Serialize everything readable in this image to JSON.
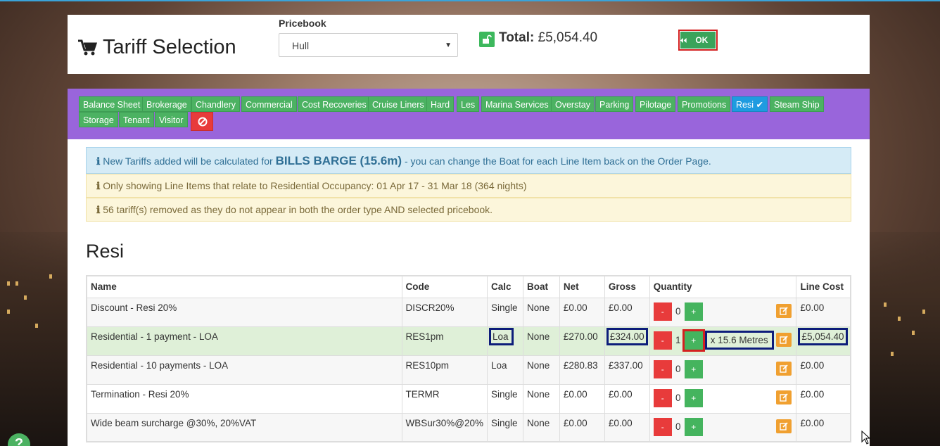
{
  "header": {
    "title": "Tariff Selection",
    "pricebook_label": "Pricebook",
    "pricebook_value": "Hull",
    "total_label": "Total:",
    "total_value": "£5,054.40",
    "ok_label": "OK"
  },
  "categories": [
    {
      "label": "Balance Sheet"
    },
    {
      "label": "Brokerage"
    },
    {
      "label": "Chandlery"
    },
    {
      "label": "Commercial"
    },
    {
      "label": "Cost Recoveries"
    },
    {
      "label": "Cruise Liners"
    },
    {
      "label": "Hard"
    },
    {
      "label": "Les"
    },
    {
      "label": "Marina Services"
    },
    {
      "label": "Overstay"
    },
    {
      "label": "Parking"
    },
    {
      "label": "Pilotage"
    },
    {
      "label": "Promotions"
    },
    {
      "label": "Resi",
      "active": true
    },
    {
      "label": "Steam Ship"
    },
    {
      "label": "Storage"
    },
    {
      "label": "Tenant"
    },
    {
      "label": "Visitor"
    }
  ],
  "alerts": {
    "info_prefix": "New Tariffs added will be calculated for",
    "info_boat": "BILLS BARGE (15.6m)",
    "info_suffix": "- you can change the Boat for each Line Item back on the Order Page.",
    "occupancy": "Only showing Line Items that relate to Residential Occupancy: 01 Apr 17 - 31 Mar 18 (364 nights)",
    "removed": "56 tariff(s) removed as they do not appear in both the order type AND selected pricebook."
  },
  "section_title": "Resi",
  "table": {
    "headers": {
      "name": "Name",
      "code": "Code",
      "calc": "Calc",
      "boat": "Boat",
      "net": "Net",
      "gross": "Gross",
      "quantity": "Quantity",
      "line_cost": "Line Cost"
    },
    "rows": [
      {
        "name": "Discount - Resi 20%",
        "code": "DISCR20%",
        "calc": "Single",
        "boat": "None",
        "net": "£0.00",
        "gross": "£0.00",
        "qty": "0",
        "line_cost": "£0.00"
      },
      {
        "name": "Residential - 1 payment - LOA",
        "code": "RES1pm",
        "calc": "Loa",
        "boat": "None",
        "net": "£270.00",
        "gross": "£324.00",
        "qty": "1",
        "metres": "x 15.6 Metres",
        "line_cost": "£5,054.40"
      },
      {
        "name": "Residential - 10 payments - LOA",
        "code": "RES10pm",
        "calc": "Loa",
        "boat": "None",
        "net": "£280.83",
        "gross": "£337.00",
        "qty": "0",
        "line_cost": "£0.00"
      },
      {
        "name": "Termination - Resi 20%",
        "code": "TERMR",
        "calc": "Single",
        "boat": "None",
        "net": "£0.00",
        "gross": "£0.00",
        "qty": "0",
        "line_cost": "£0.00"
      },
      {
        "name": "Wide beam surcharge @30%, 20%VAT",
        "code": "WBSur30%@20%",
        "calc": "Single",
        "boat": "None",
        "net": "£0.00",
        "gross": "£0.00",
        "qty": "0",
        "line_cost": "£0.00"
      }
    ]
  },
  "buttons": {
    "minus": "-",
    "plus": "+"
  },
  "help_label": "?",
  "colors": {
    "purple_bar": "#9965db",
    "tag_green": "#4cb262",
    "active_blue": "#1e9be0",
    "danger_red": "#e83b3b"
  }
}
